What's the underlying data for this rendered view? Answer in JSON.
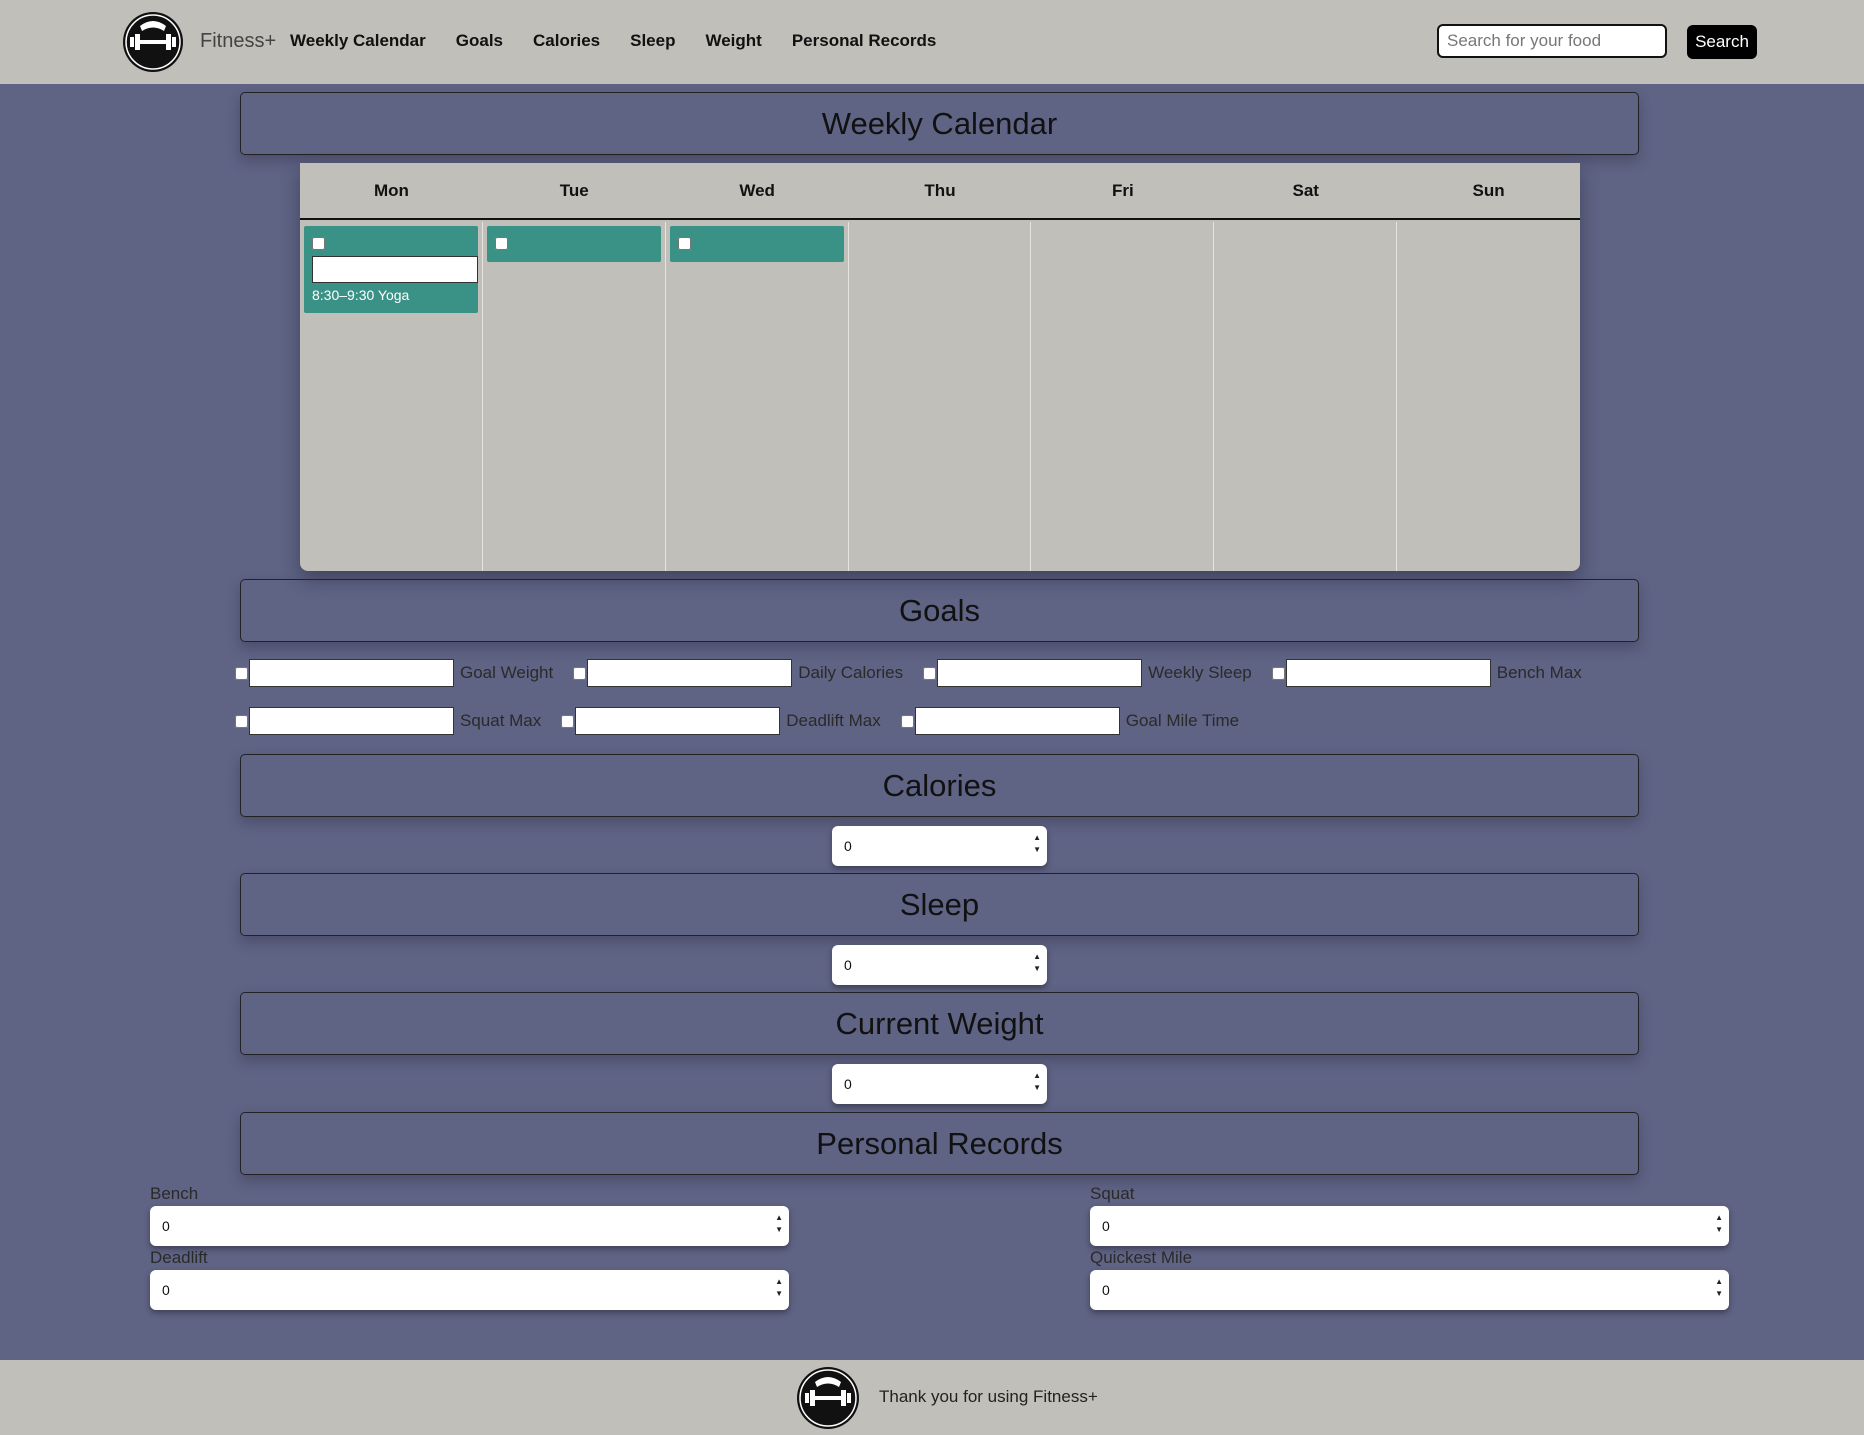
{
  "header": {
    "brand": "Fitness+",
    "nav": [
      "Weekly Calendar",
      "Goals",
      "Calories",
      "Sleep",
      "Weight",
      "Personal Records"
    ],
    "search_placeholder": "Search for your food",
    "search_button": "Search"
  },
  "sections": {
    "calendar_title": "Weekly Calendar",
    "goals_title": "Goals",
    "calories_title": "Calories",
    "sleep_title": "Sleep",
    "weight_title": "Current Weight",
    "records_title": "Personal Records"
  },
  "calendar": {
    "days": [
      "Mon",
      "Tue",
      "Wed",
      "Thu",
      "Fri",
      "Sat",
      "Sun"
    ],
    "events": {
      "mon_label": "8:30–9:30 Yoga"
    }
  },
  "goals": {
    "row1": [
      "Goal Weight",
      "Daily Calories",
      "Weekly Sleep",
      "Bench Max"
    ],
    "row2": [
      "Squat Max",
      "Deadlift Max",
      "Goal Mile Time"
    ]
  },
  "inputs": {
    "calories": "0",
    "sleep": "0",
    "weight": "0"
  },
  "records": {
    "bench_label": "Bench",
    "bench_value": "0",
    "squat_label": "Squat",
    "squat_value": "0",
    "deadlift_label": "Deadlift",
    "deadlift_value": "0",
    "mile_label": "Quickest Mile",
    "mile_value": "0"
  },
  "footer": {
    "text": "Thank you for using Fitness+"
  }
}
